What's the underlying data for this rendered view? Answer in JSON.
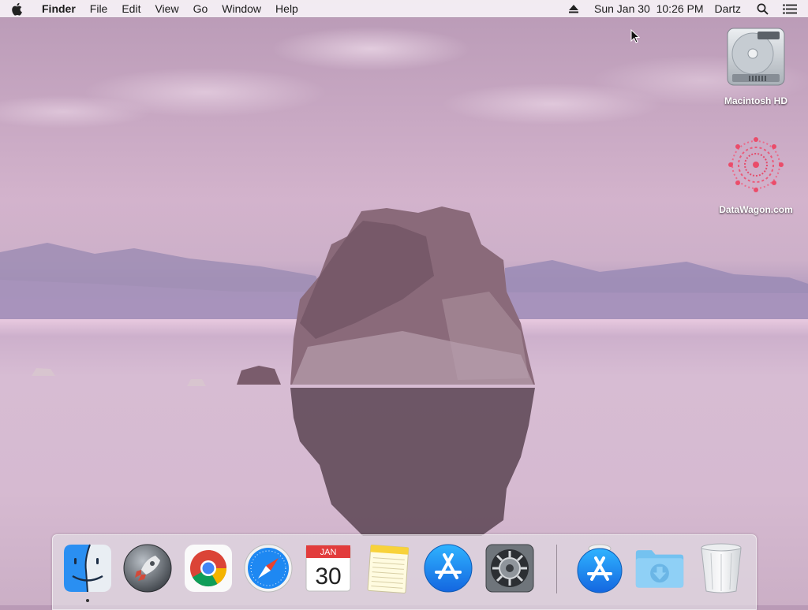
{
  "menubar": {
    "app_name": "Finder",
    "menus": [
      "File",
      "Edit",
      "View",
      "Go",
      "Window",
      "Help"
    ],
    "datetime": "Sun Jan 30  10:26 PM",
    "user": "Dartz"
  },
  "desktop_icons": [
    {
      "label": "Macintosh HD",
      "icon": "hard-drive-icon"
    },
    {
      "label": "DataWagon.com",
      "icon": "datawagon-logo-icon"
    }
  ],
  "dock": {
    "apps": [
      {
        "name": "Finder",
        "icon": "finder-icon",
        "running": true
      },
      {
        "name": "Launchpad",
        "icon": "launchpad-icon",
        "running": false
      },
      {
        "name": "Google Chrome",
        "icon": "chrome-icon",
        "running": false
      },
      {
        "name": "Safari",
        "icon": "safari-icon",
        "running": false
      },
      {
        "name": "Calendar",
        "icon": "calendar-icon",
        "running": false
      },
      {
        "name": "Notes",
        "icon": "notes-icon",
        "running": false
      },
      {
        "name": "App Store",
        "icon": "app-store-icon",
        "running": false
      },
      {
        "name": "System Preferences",
        "icon": "system-preferences-icon",
        "running": false
      }
    ],
    "calendar": {
      "month": "JAN",
      "day": "30"
    },
    "others": [
      {
        "name": "Install App Store",
        "icon": "app-store-installer-icon"
      },
      {
        "name": "Downloads",
        "icon": "downloads-folder-icon"
      },
      {
        "name": "Trash",
        "icon": "trash-icon"
      }
    ]
  },
  "colors": {
    "accent_blue": "#1e88f2",
    "menubar_bg": "#f6f2f6",
    "desktop_pink": "#d2b6d0"
  }
}
